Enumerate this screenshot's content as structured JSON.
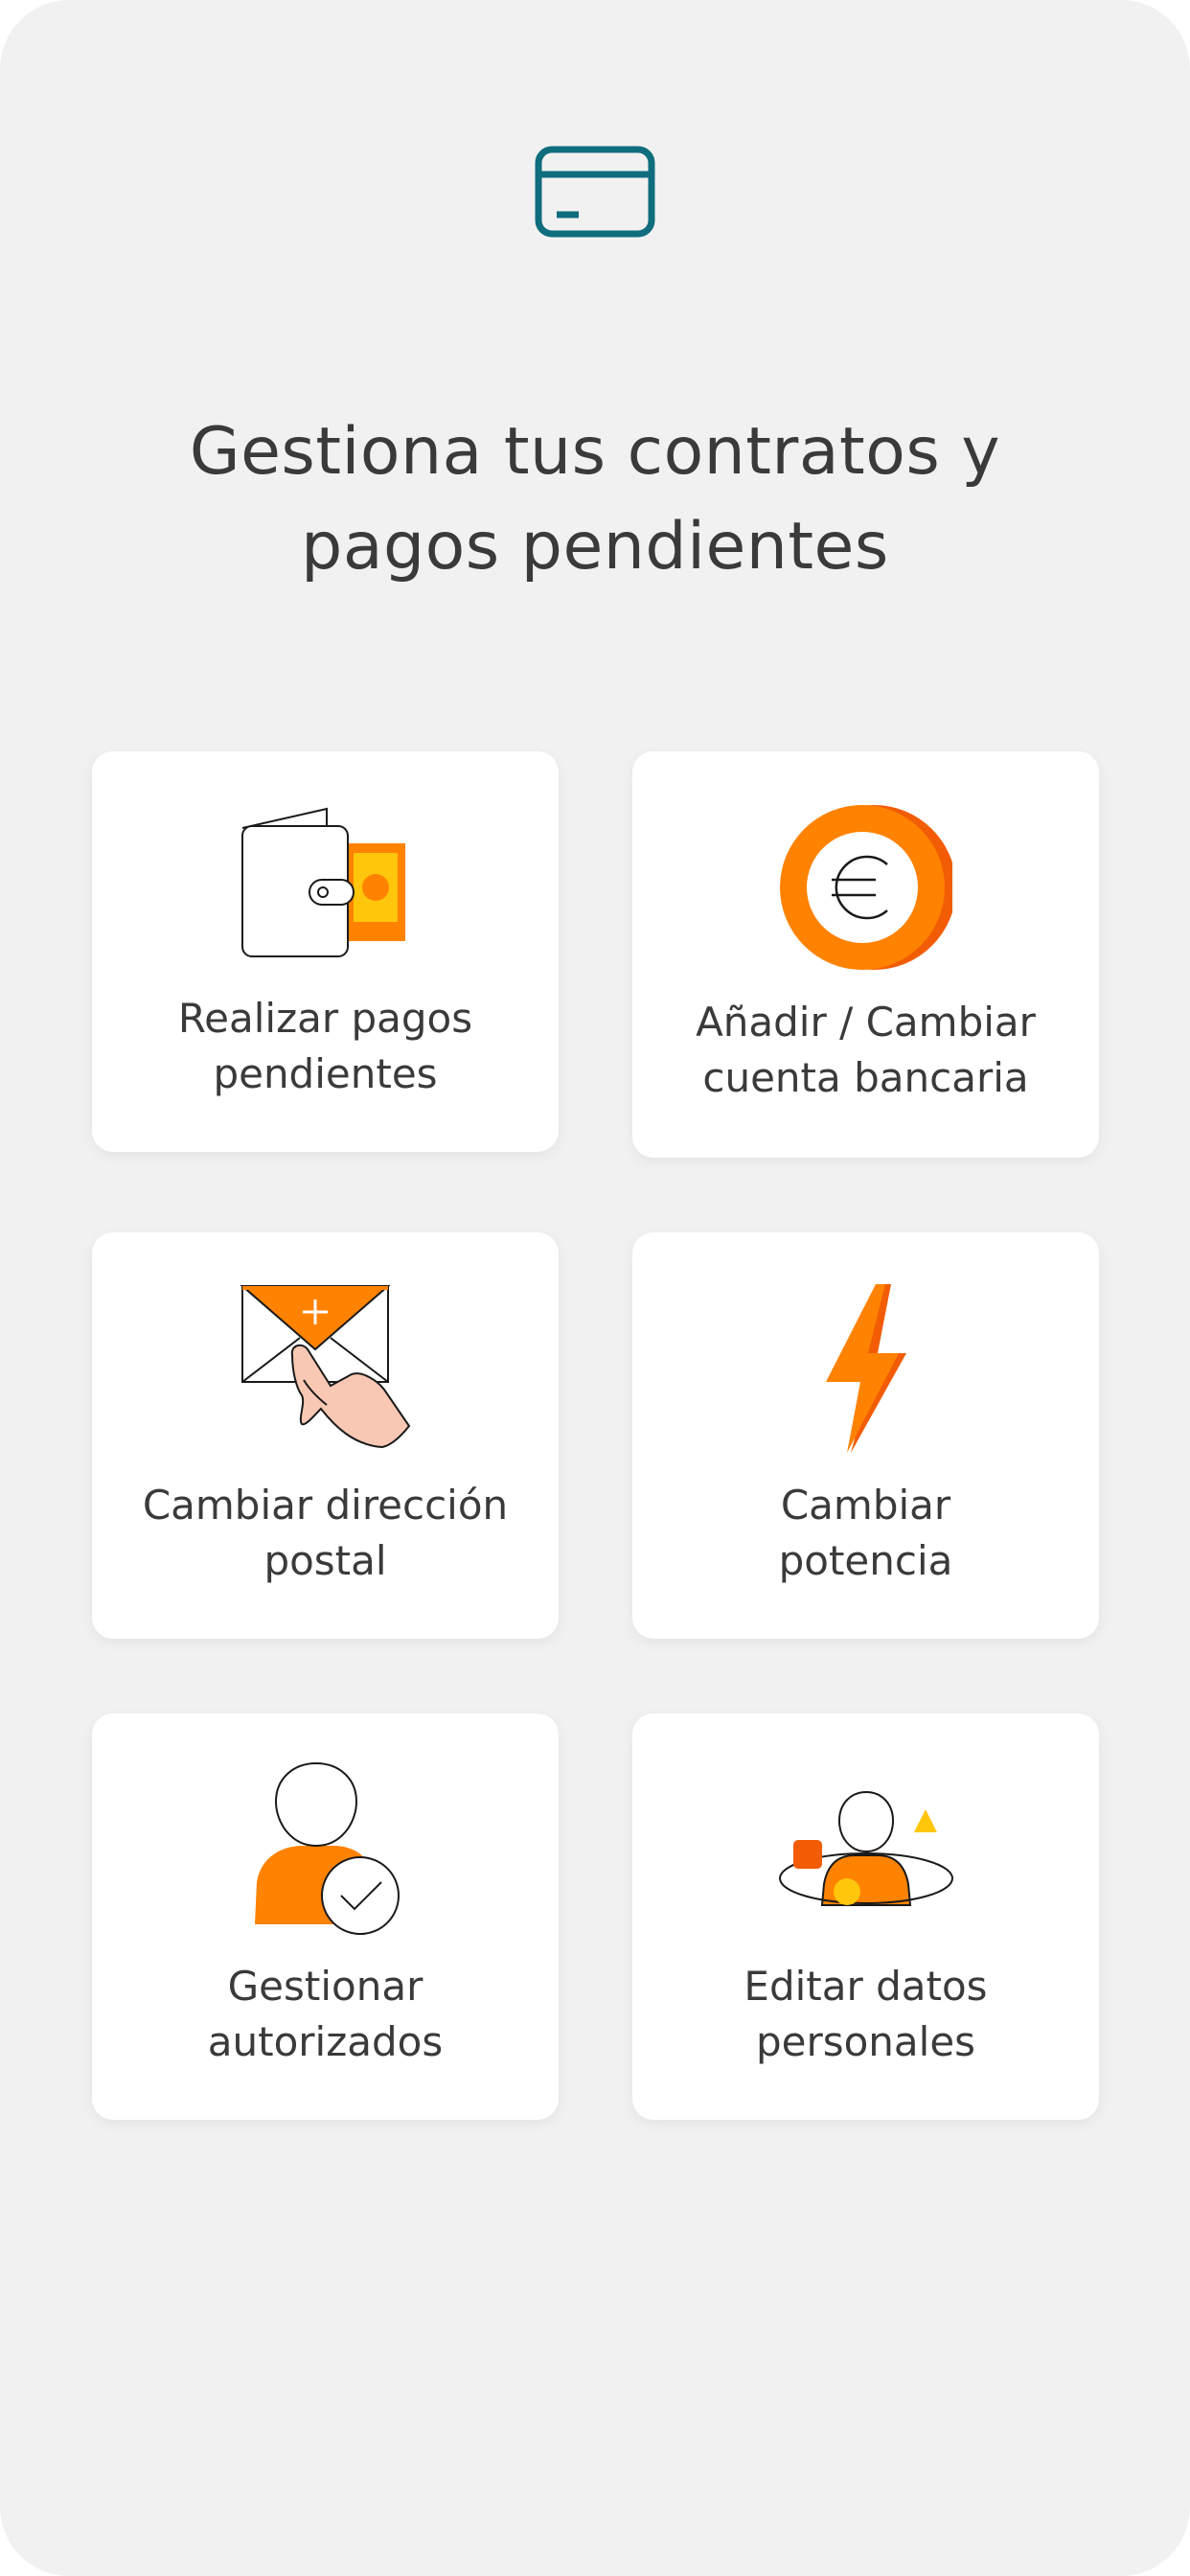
{
  "header": {
    "icon": "credit-card-icon",
    "title": "Gestiona tus contratos y\npagos pendientes"
  },
  "colors": {
    "accent_teal": "#0f6d7e",
    "orange": "#ff8200",
    "orange_dark": "#f25c05",
    "yellow": "#ffc60b",
    "skin": "#f9c8b4",
    "background": "#f1f1f1",
    "card": "#ffffff",
    "text": "#3a3a3a"
  },
  "cards": [
    {
      "icon": "wallet-icon",
      "label": "Realizar pagos\npendientes"
    },
    {
      "icon": "euro-coin-icon",
      "label": "Añadir / Cambiar\ncuenta bancaria"
    },
    {
      "icon": "envelope-hand-icon",
      "label": "Cambiar dirección\npostal"
    },
    {
      "icon": "lightning-bolt-icon",
      "label": "Cambiar\npotencia"
    },
    {
      "icon": "authorized-user-icon",
      "label": "Gestionar\nautorizados"
    },
    {
      "icon": "user-profile-icon",
      "label": "Editar datos\npersonales"
    }
  ]
}
